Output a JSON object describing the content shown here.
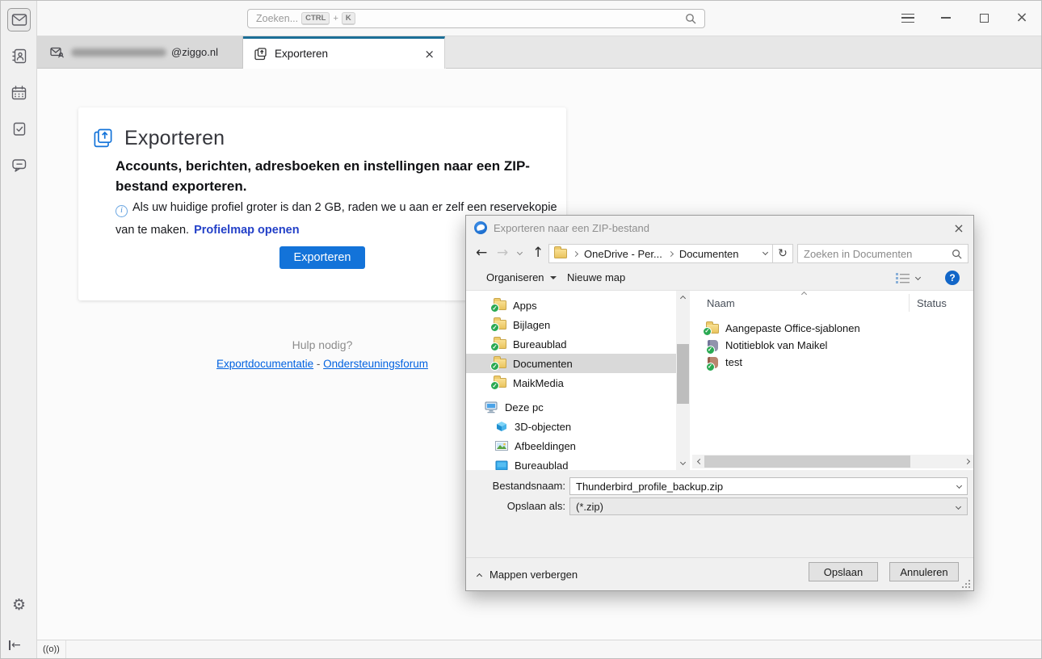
{
  "colors": {
    "accent_blue": "#1373d9",
    "active_tab_indicator": "#1b6e96",
    "onedrive_sync_green": "#2aa952",
    "help_icon_blue": "#1266c8",
    "help_link_blue": "#0061e0",
    "profile_link_blue": "#2441c8"
  },
  "icons": {
    "close": "×",
    "back": "←",
    "forward": "→",
    "up": "↑",
    "refresh": "↻",
    "gear": "⚙",
    "check": "✓",
    "info": "i",
    "help": "?",
    "status_broadcast": "((o))",
    "spaces": [
      "mail",
      "address-book",
      "calendar",
      "tasks",
      "chat",
      "settings",
      "collapse"
    ]
  },
  "toolbar": {
    "search_placeholder": "Zoeken...",
    "shortcut_ctrl": "CTRL",
    "shortcut_plus": "+",
    "shortcut_key": "K"
  },
  "tabs": {
    "mail_tab_label": "@ziggo.nl",
    "export_tab_label": "Exporteren"
  },
  "export_page": {
    "title": "Exporteren",
    "subtitle": "Accounts, berichten, adresboeken en instellingen naar een ZIP-bestand exporteren.",
    "note": "Als uw huidige profiel groter is dan 2 GB, raden we u aan er zelf een reservekopie van te maken.",
    "profile_link": "Profielmap openen",
    "export_button": "Exporteren",
    "help_heading": "Hulp nodig?",
    "help_link_docs": "Exportdocumentatie",
    "help_separator": "-",
    "help_link_forum": "Ondersteuningsforum"
  },
  "dialog": {
    "title": "Exporteren naar een ZIP-bestand",
    "breadcrumb": {
      "item1": "OneDrive - Per...",
      "item2": "Documenten"
    },
    "search_placeholder": "Zoeken in Documenten",
    "organize_button": "Organiseren",
    "new_folder_button": "Nieuwe map",
    "tree": [
      {
        "label": "Apps",
        "icon": "folder-synced"
      },
      {
        "label": "Bijlagen",
        "icon": "folder-synced"
      },
      {
        "label": "Bureaublad",
        "icon": "folder-synced"
      },
      {
        "label": "Documenten",
        "icon": "folder-synced",
        "selected": true
      },
      {
        "label": "MaikMedia",
        "icon": "folder-synced"
      },
      {
        "label": "Deze pc",
        "icon": "computer"
      },
      {
        "label": "3D-objecten",
        "icon": "3d-objects"
      },
      {
        "label": "Afbeeldingen",
        "icon": "pictures"
      },
      {
        "label": "Bureaublad",
        "icon": "desktop"
      }
    ],
    "columns": {
      "name": "Naam",
      "status": "Status"
    },
    "files": [
      {
        "name": "Aangepaste Office-sjablonen",
        "icon": "folder-synced"
      },
      {
        "name": "Notitieblok van Maikel",
        "icon": "notebook-synced"
      },
      {
        "name": "test",
        "icon": "notebook-synced"
      }
    ],
    "filename_label": "Bestandsnaam:",
    "filename_value": "Thunderbird_profile_backup.zip",
    "saveas_label": "Opslaan als:",
    "saveas_value": "(*.zip)",
    "hide_folders_label": "Mappen verbergen",
    "save_button": "Opslaan",
    "cancel_button": "Annuleren"
  }
}
